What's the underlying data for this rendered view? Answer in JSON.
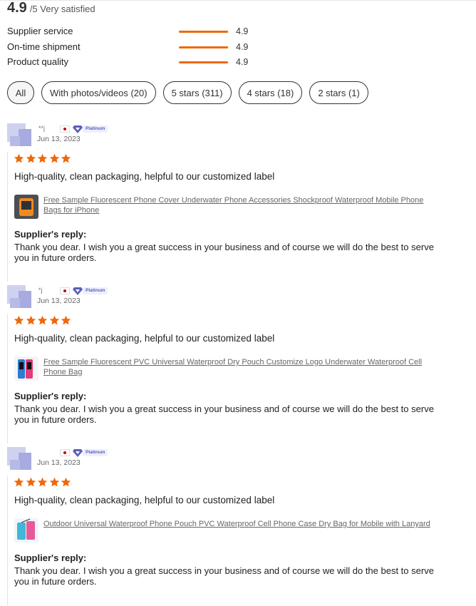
{
  "summary": {
    "score": "4.9",
    "suffix": "/5 Very satisfied"
  },
  "metrics": [
    {
      "label": "Supplier service",
      "value": "4.9",
      "fill": 0.98
    },
    {
      "label": "On-time shipment",
      "value": "4.9",
      "fill": 0.98
    },
    {
      "label": "Product quality",
      "value": "4.9",
      "fill": 0.98
    }
  ],
  "filters": [
    {
      "label": "All",
      "active": true
    },
    {
      "label": "With photos/videos (20)"
    },
    {
      "label": "5 stars (311)"
    },
    {
      "label": "4 stars (18)"
    },
    {
      "label": "2 stars (1)"
    }
  ],
  "colors": {
    "accent": "#ec6a0c",
    "badge": "#5a5fbd"
  },
  "reviews": [
    {
      "user": "**j",
      "badge": "Platinum",
      "date": "Jun 13, 2023",
      "rating": 5,
      "text": "High-quality, clean packaging, helpful to our customized label",
      "product_title": "Free Sample Fluorescent Phone Cover Underwater Phone Accessories Shockproof Waterproof Mobile Phone Bags for iPhone",
      "reply_heading": "Supplier's reply:",
      "reply": "Thank you dear. I wish you a great success in your business and of course we will do the best to serve you in future orders."
    },
    {
      "user": "*j",
      "badge": "Platinum",
      "date": "Jun 13, 2023",
      "rating": 5,
      "text": "High-quality, clean packaging, helpful to our customized label",
      "product_title": "Free Sample Fluorescent PVC Universal Waterproof Dry Pouch Customize Logo Underwater Waterproof Cell Phone Bag",
      "reply_heading": "Supplier's reply:",
      "reply": "Thank you dear. I wish you a great success in your business and of course we will do the best to serve you in future orders."
    },
    {
      "user": "",
      "badge": "Platinum",
      "date": "Jun 13, 2023",
      "rating": 5,
      "text": "High-quality, clean packaging, helpful to our customized label",
      "product_title": "Outdoor Universal Waterproof Phone Pouch PVC Waterproof Cell Phone Case Dry Bag for Mobile with Lanyard",
      "reply_heading": "Supplier's reply:",
      "reply": "Thank you dear. I wish you a great success in your business and of course we will do the best to serve you in future orders."
    }
  ]
}
